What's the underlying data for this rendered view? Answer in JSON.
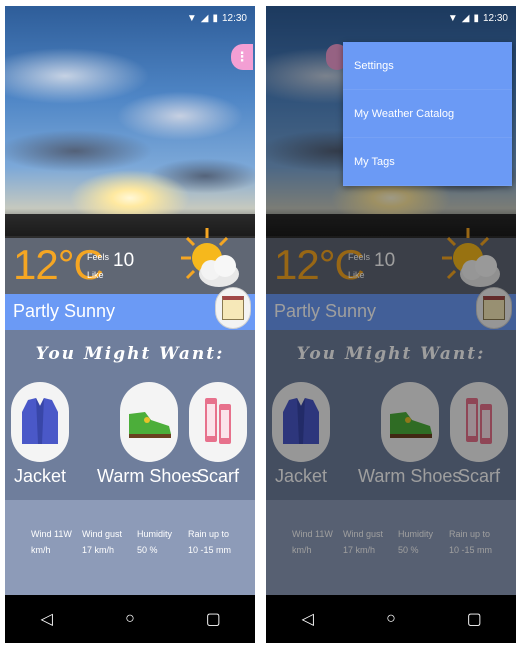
{
  "status": {
    "time": "12:30"
  },
  "weather": {
    "temperature": "12°C",
    "feels_label_1": "Feels",
    "feels_label_2": "Like",
    "feels_value": "10",
    "condition": "Partly Sunny"
  },
  "suggestions": {
    "heading": "You Might Want:",
    "items": [
      {
        "label": "Jacket"
      },
      {
        "label": "Warm Shoes"
      },
      {
        "label": "Scarf"
      }
    ]
  },
  "details": [
    {
      "line1": "Wind 11W",
      "line2": "km/h"
    },
    {
      "line1": "Wind gust",
      "line2": "17 km/h"
    },
    {
      "line1": "Humidity",
      "line2": "50 %"
    },
    {
      "line1": "Rain up to",
      "line2": "10 -15 mm"
    }
  ],
  "menu": {
    "items": [
      {
        "label": "Settings"
      },
      {
        "label": "My Weather Catalog"
      },
      {
        "label": "My Tags"
      }
    ]
  },
  "colors": {
    "accent_blue": "#6b9af5",
    "temp_orange": "#f5a623",
    "menu_fab_pink": "#f39fd4"
  }
}
